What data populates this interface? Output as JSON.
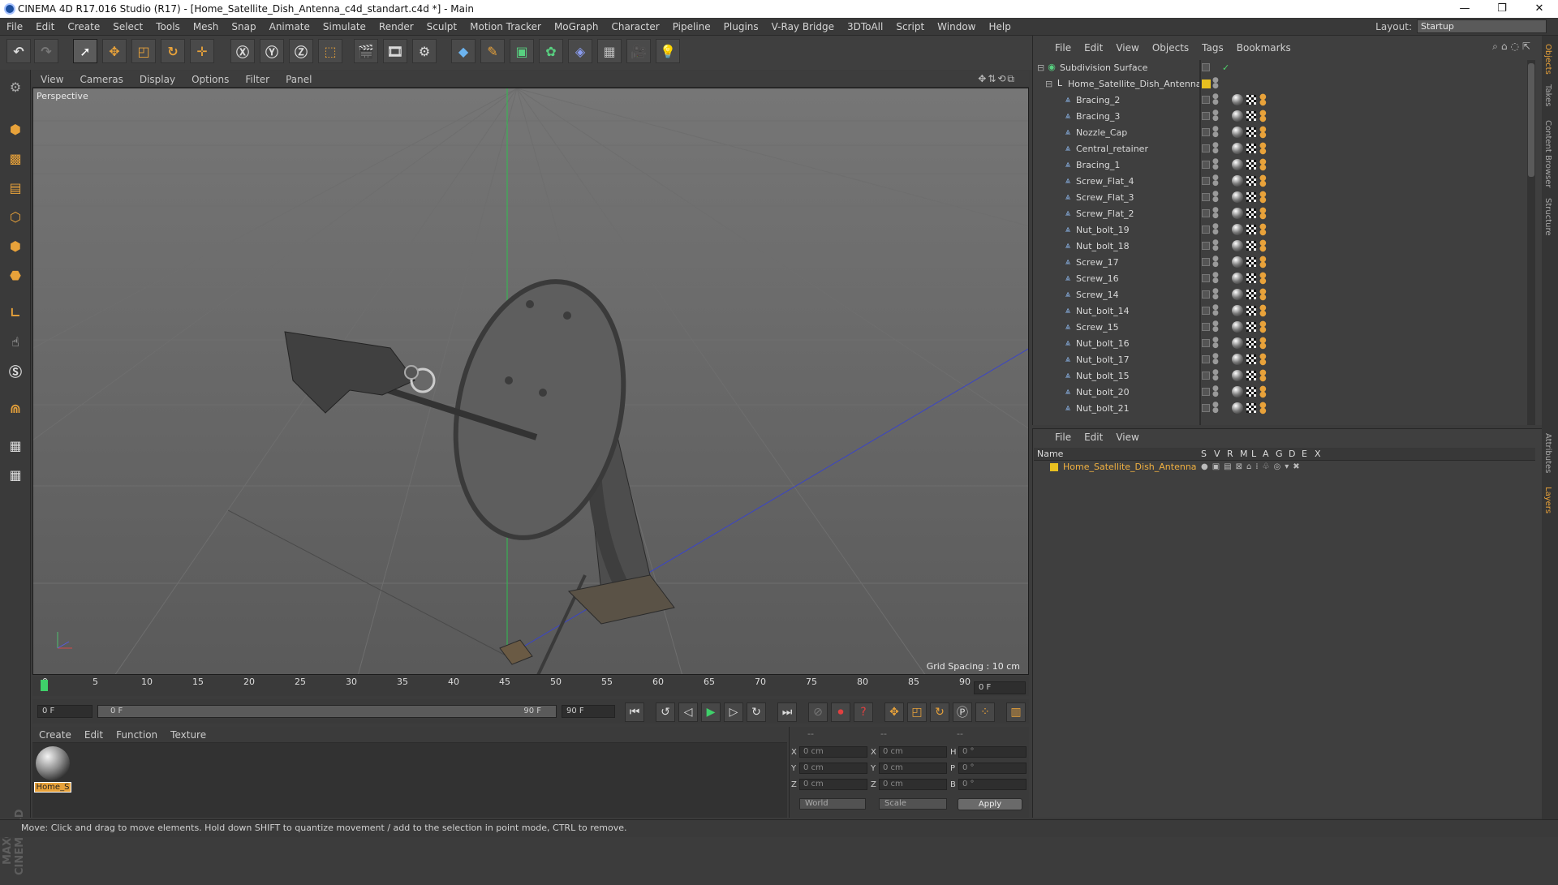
{
  "window": {
    "title": "CINEMA 4D R17.016 Studio (R17) - [Home_Satellite_Dish_Antenna_c4d_standart.c4d *] - Main",
    "min": "—",
    "max": "❐",
    "close": "✕"
  },
  "menubar": [
    "File",
    "Edit",
    "Create",
    "Select",
    "Tools",
    "Mesh",
    "Snap",
    "Animate",
    "Simulate",
    "Render",
    "Sculpt",
    "Motion Tracker",
    "MoGraph",
    "Character",
    "Pipeline",
    "Plugins",
    "V-Ray Bridge",
    "3DToAll",
    "Script",
    "Window",
    "Help"
  ],
  "layout": {
    "label": "Layout:",
    "value": "Startup"
  },
  "viewport": {
    "menu": [
      "View",
      "Cameras",
      "Display",
      "Options",
      "Filter",
      "Panel"
    ],
    "label": "Perspective",
    "grid_spacing": "Grid Spacing : 10 cm"
  },
  "timeline": {
    "ticks": [
      "0",
      "5",
      "10",
      "15",
      "20",
      "25",
      "30",
      "35",
      "40",
      "45",
      "50",
      "55",
      "60",
      "65",
      "70",
      "75",
      "80",
      "85",
      "90"
    ],
    "current_frame": "0 F",
    "start_frame": "0 F",
    "range_start": "0 F",
    "range_end": "90 F",
    "end_frame": "90 F"
  },
  "material": {
    "menu": [
      "Create",
      "Edit",
      "Function",
      "Texture"
    ],
    "name": "Home_S"
  },
  "coords": {
    "headers": [
      "--",
      "--",
      "--"
    ],
    "rows": [
      {
        "a": "X",
        "av": "0 cm",
        "b": "X",
        "bv": "0 cm",
        "c": "H",
        "cv": "0 °"
      },
      {
        "a": "Y",
        "av": "0 cm",
        "b": "Y",
        "bv": "0 cm",
        "c": "P",
        "cv": "0 °"
      },
      {
        "a": "Z",
        "av": "0 cm",
        "b": "Z",
        "bv": "0 cm",
        "c": "B",
        "cv": "0 °"
      }
    ],
    "world": "World",
    "scale": "Scale",
    "apply": "Apply"
  },
  "status": "Move: Click and drag to move elements. Hold down SHIFT to quantize movement / add to the selection in point mode, CTRL to remove.",
  "objects": {
    "menu": [
      "File",
      "Edit",
      "View",
      "Objects",
      "Tags",
      "Bookmarks"
    ],
    "root": "Subdivision Surface",
    "group": "Home_Satellite_Dish_Antenna",
    "items": [
      "Bracing_2",
      "Bracing_3",
      "Nozzle_Cap",
      "Central_retainer",
      "Bracing_1",
      "Screw_Flat_4",
      "Screw_Flat_3",
      "Screw_Flat_2",
      "Nut_bolt_19",
      "Nut_bolt_18",
      "Screw_17",
      "Screw_16",
      "Screw_14",
      "Nut_bolt_14",
      "Screw_15",
      "Nut_bolt_16",
      "Nut_bolt_17",
      "Nut_bolt_15",
      "Nut_bolt_20",
      "Nut_bolt_21"
    ]
  },
  "layers": {
    "menu": [
      "File",
      "Edit",
      "View"
    ],
    "header_name": "Name",
    "columns": [
      "S",
      "V",
      "R",
      "M",
      "L",
      "A",
      "G",
      "D",
      "E",
      "X"
    ],
    "row": "Home_Satellite_Dish_Antenna",
    "layer_color": "#e8c020"
  },
  "side_tabs": [
    "Objects",
    "Takes",
    "Content Browser",
    "Structure",
    "Attributes",
    "Layers"
  ],
  "logo_text": "MAXON CINEMA 4D",
  "colors": {
    "accent": "#e8a23a",
    "selected_text": "#f0b040"
  }
}
